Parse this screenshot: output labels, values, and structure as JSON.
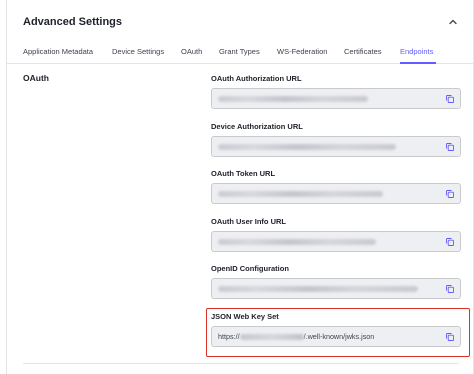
{
  "header": {
    "title": "Advanced Settings"
  },
  "tabs": [
    {
      "label": "Application Metadata",
      "active": false
    },
    {
      "label": "Device Settings",
      "active": false
    },
    {
      "label": "OAuth",
      "active": false
    },
    {
      "label": "Grant Types",
      "active": false
    },
    {
      "label": "WS-Federation",
      "active": false
    },
    {
      "label": "Certificates",
      "active": false
    },
    {
      "label": "Endpoints",
      "active": true
    }
  ],
  "section": {
    "label": "OAuth"
  },
  "fields": [
    {
      "label": "OAuth Authorization URL",
      "value": ""
    },
    {
      "label": "Device Authorization URL",
      "value": ""
    },
    {
      "label": "OAuth Token URL",
      "value": ""
    },
    {
      "label": "OAuth User Info URL",
      "value": ""
    },
    {
      "label": "OpenID Configuration",
      "value": ""
    },
    {
      "label": "JSON Web Key Set",
      "value_prefix": "https://",
      "value_suffix": "/.well-known/jwks.json"
    }
  ],
  "colors": {
    "accent": "#635dff",
    "highlight": "#d9322a",
    "field_bg": "#eeeff2"
  },
  "icons": {
    "collapse": "chevron-up-icon",
    "copy": "copy-icon"
  }
}
